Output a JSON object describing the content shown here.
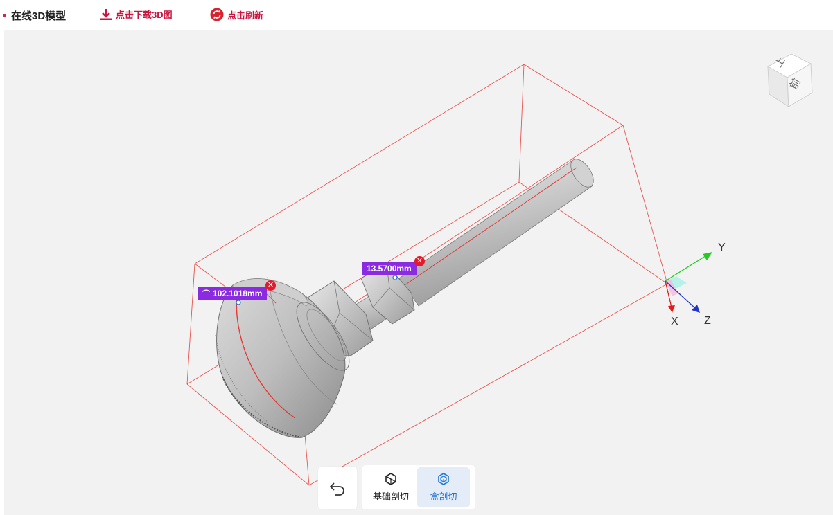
{
  "header": {
    "title": "在线3D模型",
    "download_label": "点击下载3D图",
    "refresh_label": "点击刷新"
  },
  "measurements": [
    {
      "value": "102.1018mm",
      "kind": "arc"
    },
    {
      "value": "13.5700mm",
      "kind": "distance"
    }
  ],
  "axes": {
    "x": "X",
    "y": "Y",
    "z": "Z"
  },
  "view_cube": {
    "top": "上",
    "front": "前"
  },
  "toolbar": {
    "basic_cut_label": "基础剖切",
    "box_cut_label": "盒剖切",
    "active": "盒剖切"
  },
  "colors": {
    "accent": "#c8163f",
    "measurement": "#8a2be2",
    "bounding_box": "#e53935",
    "active_tool": "#1f74d6"
  },
  "icons": [
    "download-icon",
    "refresh-icon",
    "undo-icon",
    "basic-cut-icon",
    "box-cut-icon",
    "close-icon"
  ]
}
